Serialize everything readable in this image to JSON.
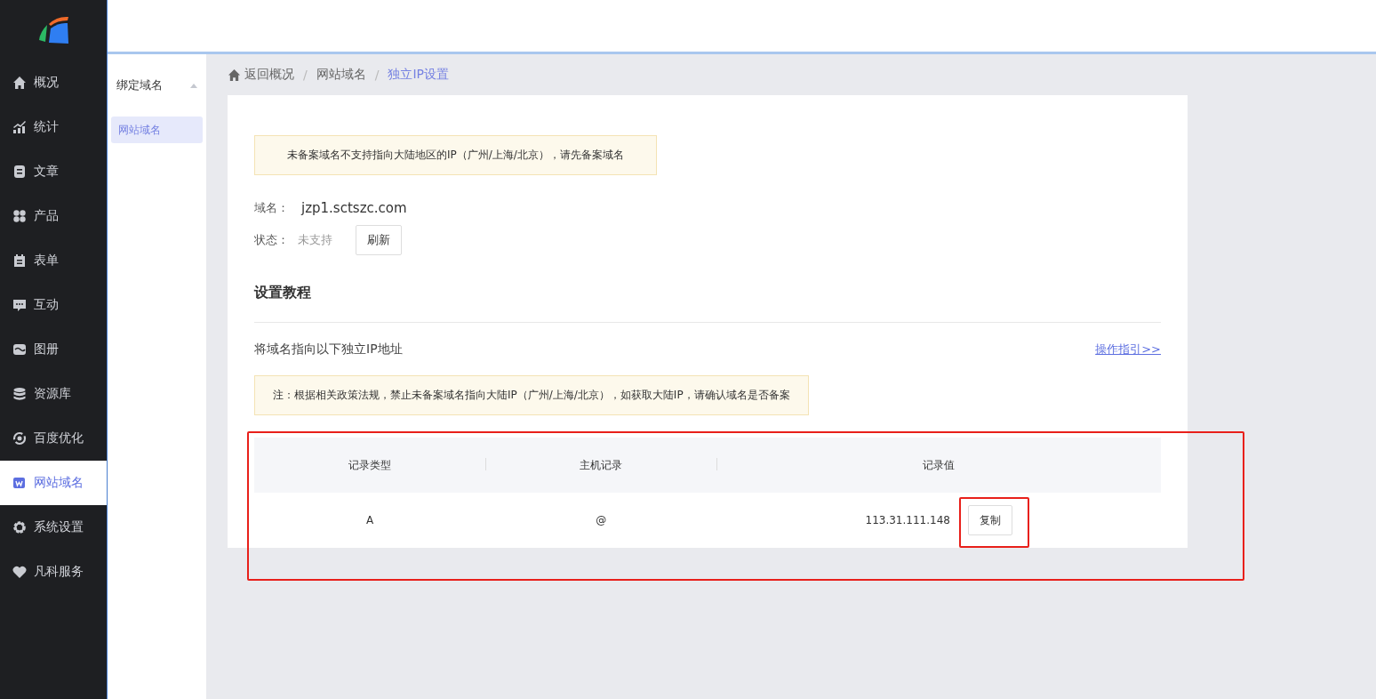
{
  "sidebar": {
    "items": [
      {
        "label": "概况",
        "selected": false
      },
      {
        "label": "统计",
        "selected": false
      },
      {
        "label": "文章",
        "selected": false
      },
      {
        "label": "产品",
        "selected": false
      },
      {
        "label": "表单",
        "selected": false
      },
      {
        "label": "互动",
        "selected": false
      },
      {
        "label": "图册",
        "selected": false
      },
      {
        "label": "资源库",
        "selected": false
      },
      {
        "label": "百度优化",
        "selected": false
      },
      {
        "label": "网站域名",
        "selected": true
      },
      {
        "label": "系统设置",
        "selected": false
      },
      {
        "label": "凡科服务",
        "selected": false
      }
    ]
  },
  "subnav": {
    "group": {
      "label": "绑定域名",
      "expanded": true
    },
    "items": [
      {
        "label": "网站域名",
        "selected": true
      }
    ]
  },
  "breadcrumb": [
    {
      "label": "返回概况",
      "current": false
    },
    {
      "separator": "/",
      "label": "网站域名",
      "current": false
    },
    {
      "separator": "/",
      "label": "独立IP设置",
      "current": true
    }
  ],
  "notice": "未备案域名不支持指向大陆地区的IP（广州/上海/北京），请先备案域名",
  "domain": {
    "label": "域名：",
    "value": "jzp1.sctszc.com"
  },
  "status": {
    "label": "状态：",
    "value": "未支持",
    "button": "刷新"
  },
  "tutorial": {
    "title": "设置教程",
    "intro": "将域名指向以下独立IP地址",
    "guide_link": "操作指引>>",
    "note": "注：根据相关政策法规，禁止未备案域名指向大陆IP（广州/上海/北京），如获取大陆IP，请确认域名是否备案"
  },
  "table": {
    "columns": [
      "记录类型",
      "主机记录",
      "记录值"
    ],
    "rows": [
      {
        "type": "A",
        "host": "@",
        "value": "113.31.111.148",
        "button": "复制"
      }
    ]
  }
}
